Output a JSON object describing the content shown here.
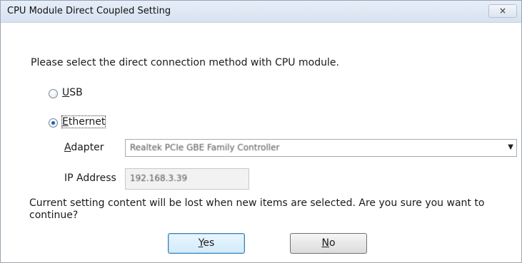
{
  "window": {
    "title": "CPU Module Direct Coupled Setting",
    "close_icon": "×"
  },
  "prompt": "Please select the direct connection method with CPU module.",
  "connection": {
    "selected": "Ethernet",
    "usb": {
      "access_key": "U",
      "rest": "SB"
    },
    "ethernet": {
      "access_key": "E",
      "rest": "thernet"
    }
  },
  "adapter": {
    "label_key": "A",
    "label_rest": "dapter",
    "value": "Realtek PCIe GBE Family Controller"
  },
  "ip_address": {
    "label": "IP Address",
    "value": "192.168.3.39"
  },
  "warning": "Current setting content will be lost when new items are selected. Are you sure you want to continue?",
  "buttons": {
    "yes": {
      "access_key": "Y",
      "rest": "es"
    },
    "no": {
      "access_key": "N",
      "rest": "o"
    }
  }
}
